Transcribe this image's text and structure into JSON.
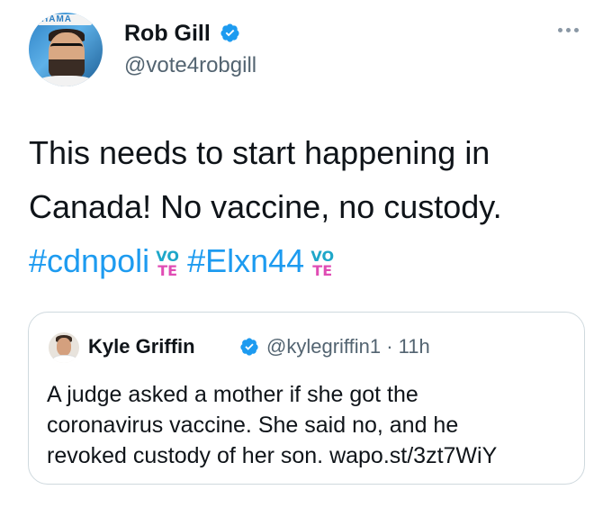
{
  "author": {
    "display_name": "Rob Gill",
    "handle": "@vote4robgill",
    "verified": true,
    "avatar_banner_text": "HAMA"
  },
  "menu_icon": "more-horizontal-icon",
  "tweet": {
    "line1": "This needs to start happening in",
    "line2": "Canada! No vaccine, no custody.",
    "hashtag1": "#cdnpoli",
    "hashtag2": "#Elxn44",
    "vote_emoji": {
      "top": "VO",
      "bottom": "TE"
    }
  },
  "quoted_tweet": {
    "display_name": "Kyle Griffin",
    "handle": "@kylegriffin1",
    "separator": "·",
    "time": "11h",
    "verified": true,
    "line1": "A judge asked a mother if she got the",
    "line2": "coronavirus vaccine. She said no, and he",
    "line3": "revoked custody of her son. wapo.st/3zt7WiY"
  },
  "colors": {
    "link": "#1d9bf0",
    "verified": "#1d9bf0",
    "secondary_text": "#536471",
    "border": "#cfd9de",
    "vote_top": "#1ea7c9",
    "vote_bottom": "#e04cb4"
  }
}
